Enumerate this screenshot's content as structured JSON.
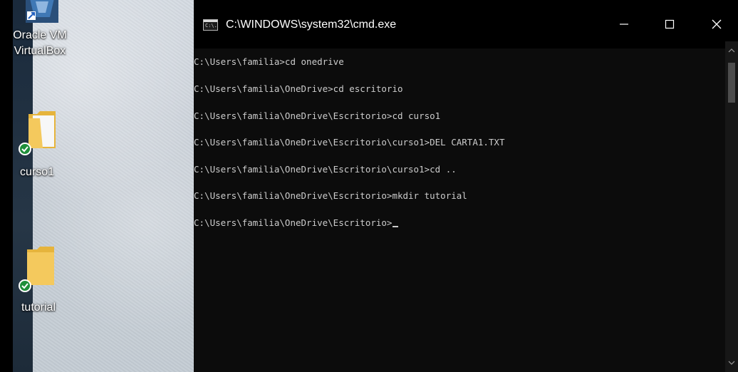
{
  "desktop": {
    "icons": [
      {
        "label_line1": "Oracle VM",
        "label_line2": "VirtualBox",
        "icon": "virtualbox-icon"
      },
      {
        "label": "curso1",
        "icon": "folder-icon"
      },
      {
        "label": "tutorial",
        "icon": "folder-icon"
      }
    ]
  },
  "window": {
    "title": "C:\\WINDOWS\\system32\\cmd.exe",
    "icon_text": "C:\\.",
    "controls": {
      "minimize": "minimize-icon",
      "maximize": "maximize-icon",
      "close": "close-icon"
    }
  },
  "console": {
    "lines": [
      "C:\\Users\\familia>cd onedrive",
      "C:\\Users\\familia\\OneDrive>cd escritorio",
      "C:\\Users\\familia\\OneDrive\\Escritorio>cd curso1",
      "C:\\Users\\familia\\OneDrive\\Escritorio\\curso1>DEL CARTA1.TXT",
      "C:\\Users\\familia\\OneDrive\\Escritorio\\curso1>cd ..",
      "C:\\Users\\familia\\OneDrive\\Escritorio>mkdir tutorial",
      "C:\\Users\\familia\\OneDrive\\Escritorio>"
    ]
  },
  "colors": {
    "console_bg": "#0c0c0c",
    "console_text": "#cccccc",
    "titlebar_bg": "#000000",
    "sync_ok": "#1f8f3a",
    "folder": "#f4c95d"
  }
}
